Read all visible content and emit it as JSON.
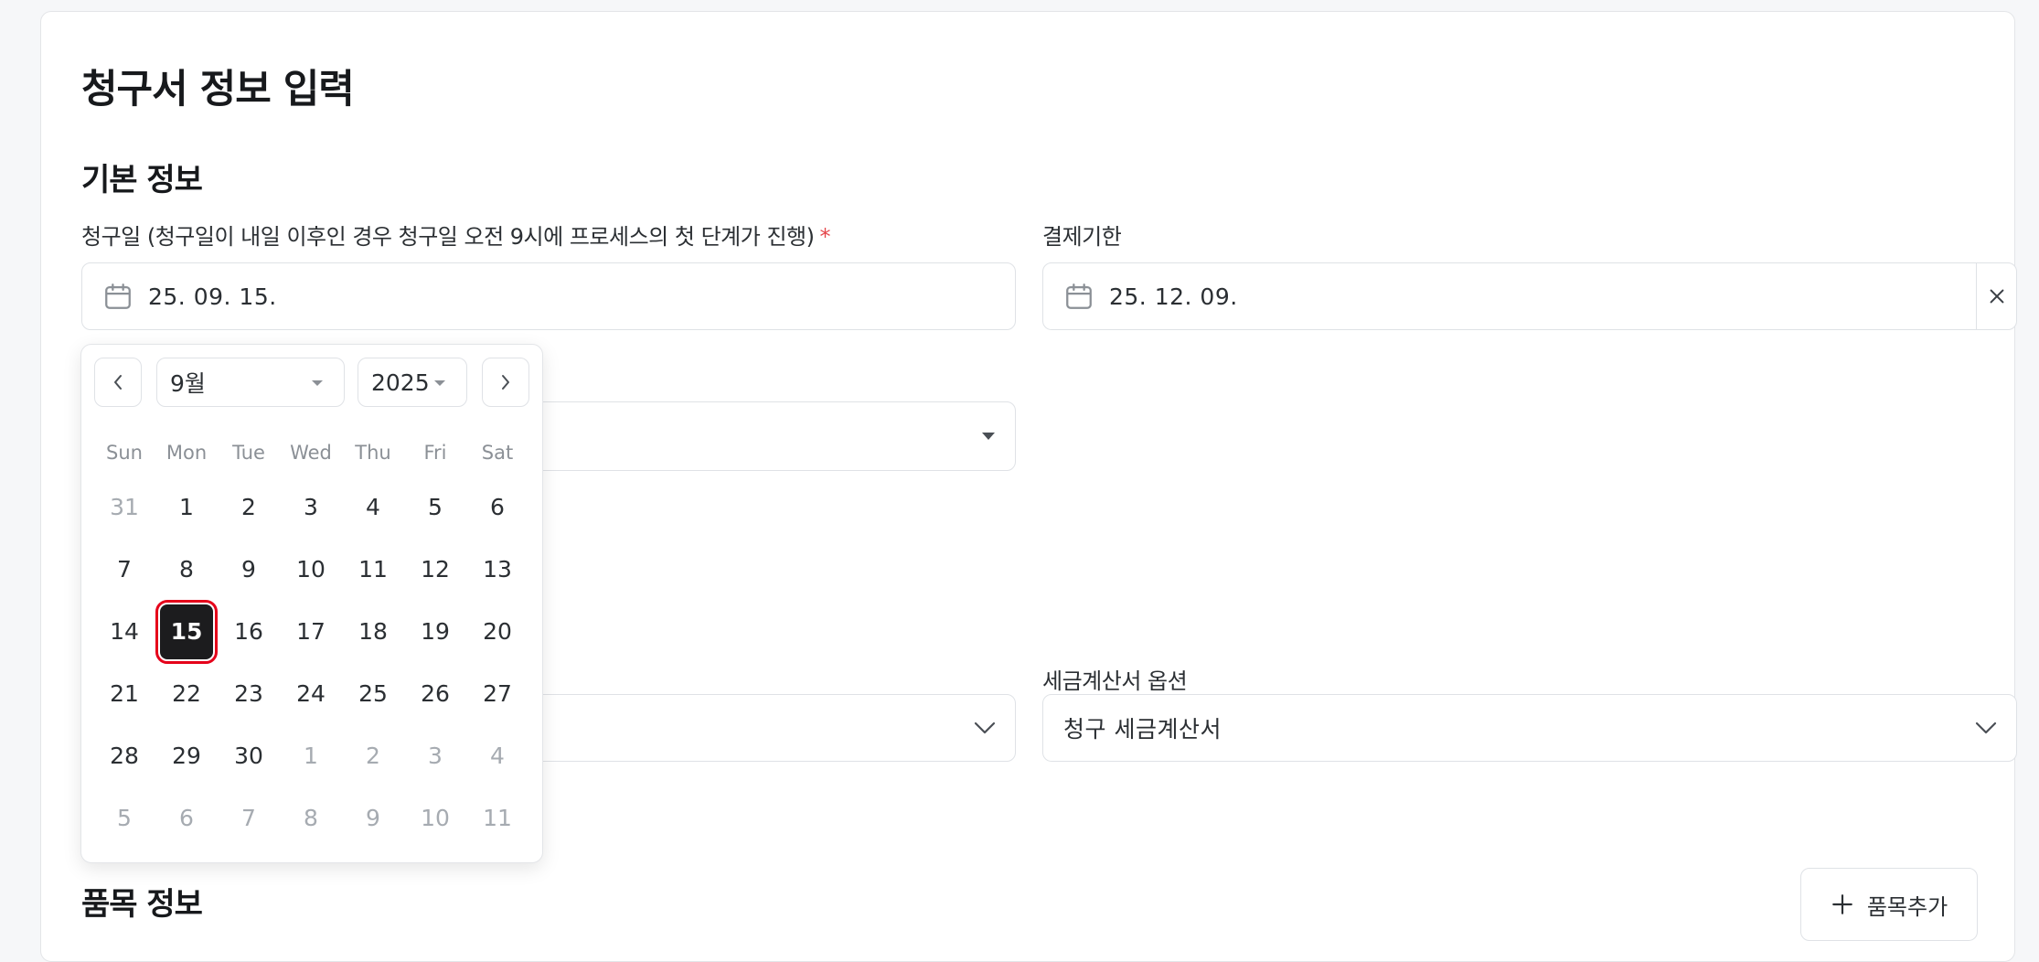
{
  "page": {
    "title": "청구서 정보 입력"
  },
  "basic_section": {
    "title": "기본 정보"
  },
  "invoice_date": {
    "label": "청구일 (청구일이 내일 이후인 경우 청구일 오전 9시에 프로세스의 첫 단계가 진행)",
    "required_mark": "*",
    "value": "25. 09. 15."
  },
  "due_date": {
    "label": "결제기한",
    "value": "25. 12. 09."
  },
  "tax_invoice": {
    "label": "세금계산서 옵션",
    "value": "청구 세금계산서"
  },
  "items_section": {
    "title": "품목 정보",
    "add_button": "품목추가"
  },
  "datepicker": {
    "month": "9월",
    "year": "2025",
    "weekdays": [
      "Sun",
      "Mon",
      "Tue",
      "Wed",
      "Thu",
      "Fri",
      "Sat"
    ],
    "weeks": [
      [
        "31",
        "1",
        "2",
        "3",
        "4",
        "5",
        "6"
      ],
      [
        "7",
        "8",
        "9",
        "10",
        "11",
        "12",
        "13"
      ],
      [
        "14",
        "15",
        "16",
        "17",
        "18",
        "19",
        "20"
      ],
      [
        "21",
        "22",
        "23",
        "24",
        "25",
        "26",
        "27"
      ],
      [
        "28",
        "29",
        "30",
        "1",
        "2",
        "3",
        "4"
      ],
      [
        "5",
        "6",
        "7",
        "8",
        "9",
        "10",
        "11"
      ]
    ],
    "selected": "15"
  },
  "colors": {
    "accent_dark": "#1c1c1e",
    "required": "#e5484d",
    "highlight": "#e5001a"
  }
}
